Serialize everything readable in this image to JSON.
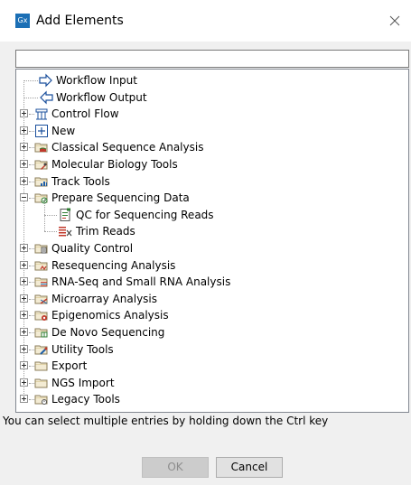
{
  "dialog": {
    "app_icon_text": "Gx",
    "title": "Add Elements",
    "close_icon": "close-icon"
  },
  "search": {
    "value": "",
    "placeholder": ""
  },
  "tree": [
    {
      "label": "Workflow Input",
      "level": 1,
      "expander": "none",
      "icon": "workflow-input-icon"
    },
    {
      "label": "Workflow Output",
      "level": 1,
      "expander": "none",
      "icon": "workflow-output-icon"
    },
    {
      "label": "Control Flow",
      "level": 0,
      "expander": "plus",
      "icon": "control-flow-icon"
    },
    {
      "label": "New",
      "level": 0,
      "expander": "plus",
      "icon": "new-icon"
    },
    {
      "label": "Classical Sequence Analysis",
      "level": 0,
      "expander": "plus",
      "icon": "classical-sequence-folder-icon"
    },
    {
      "label": "Molecular Biology Tools",
      "level": 0,
      "expander": "plus",
      "icon": "molecular-biology-folder-icon"
    },
    {
      "label": "Track Tools",
      "level": 0,
      "expander": "plus",
      "icon": "track-tools-folder-icon"
    },
    {
      "label": "Prepare Sequencing Data",
      "level": 0,
      "expander": "minus",
      "icon": "prepare-sequencing-folder-icon"
    },
    {
      "label": "QC for Sequencing Reads",
      "level": 2,
      "expander": "none",
      "icon": "qc-report-icon"
    },
    {
      "label": "Trim Reads",
      "level": 2,
      "expander": "none",
      "icon": "trim-reads-icon"
    },
    {
      "label": "Quality Control",
      "level": 0,
      "expander": "plus",
      "icon": "quality-control-folder-icon"
    },
    {
      "label": "Resequencing Analysis",
      "level": 0,
      "expander": "plus",
      "icon": "resequencing-folder-icon"
    },
    {
      "label": "RNA-Seq and Small RNA Analysis",
      "level": 0,
      "expander": "plus",
      "icon": "rna-seq-folder-icon"
    },
    {
      "label": "Microarray Analysis",
      "level": 0,
      "expander": "plus",
      "icon": "microarray-folder-icon"
    },
    {
      "label": "Epigenomics Analysis",
      "level": 0,
      "expander": "plus",
      "icon": "epigenomics-folder-icon"
    },
    {
      "label": "De Novo Sequencing",
      "level": 0,
      "expander": "plus",
      "icon": "de-novo-folder-icon"
    },
    {
      "label": "Utility Tools",
      "level": 0,
      "expander": "plus",
      "icon": "utility-tools-folder-icon"
    },
    {
      "label": "Export",
      "level": 0,
      "expander": "plus",
      "icon": "export-folder-icon"
    },
    {
      "label": "NGS Import",
      "level": 0,
      "expander": "plus",
      "icon": "ngs-import-folder-icon"
    },
    {
      "label": "Legacy Tools",
      "level": 0,
      "expander": "plus",
      "icon": "legacy-tools-folder-icon"
    }
  ],
  "hint": "You can select multiple entries by holding down the Ctrl key",
  "buttons": {
    "ok_label": "OK",
    "ok_enabled": false,
    "cancel_label": "Cancel"
  },
  "colors": {
    "app_icon": "#1b6fb5",
    "folder": "#e8d7a8",
    "workflow_icon_blue": "#1a4f9c"
  }
}
